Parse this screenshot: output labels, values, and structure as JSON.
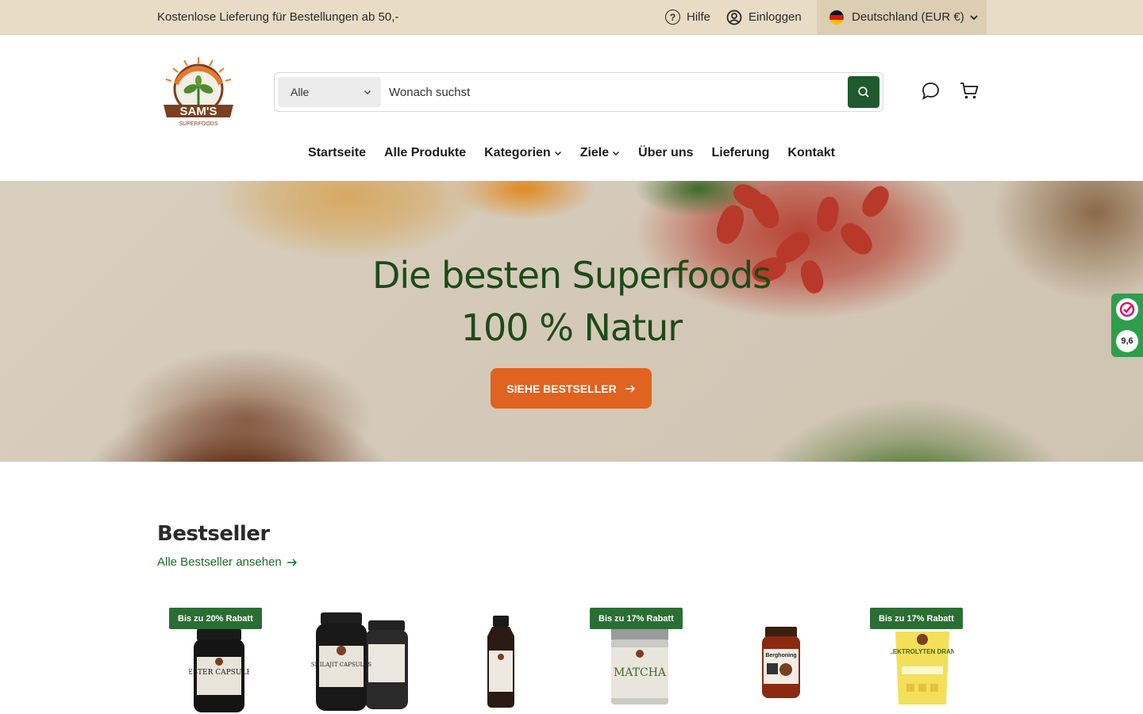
{
  "topbar": {
    "announcement": "Kostenlose Lieferung für Bestellungen ab 50,-",
    "help_label": "Hilfe",
    "login_label": "Einloggen",
    "country_label": "Deutschland (EUR €)"
  },
  "header": {
    "search": {
      "category": "Alle",
      "placeholder": "Wonach suchst"
    }
  },
  "nav": {
    "items": [
      "Startseite",
      "Alle Produkte",
      "Kategorien",
      "Ziele",
      "Über uns",
      "Lieferung",
      "Kontakt"
    ]
  },
  "hero": {
    "title_line1": "Die besten Superfoods",
    "title_line2": "100 % Natur",
    "cta_label": "SIEHE BESTSELLER"
  },
  "widget": {
    "score": "9,6"
  },
  "bestseller": {
    "title": "Bestseller",
    "link_label": "Alle Bestseller ansehen",
    "products": [
      {
        "badge": "Bis zu 20% Rabatt",
        "label": "OESTER CAPSULES"
      },
      {
        "badge": "",
        "label": "SHILAJIT CAPSULES"
      },
      {
        "badge": "",
        "label": ""
      },
      {
        "badge": "Bis zu 17% Rabatt",
        "label": "MATCHA"
      },
      {
        "badge": "",
        "label": "Berghoning"
      },
      {
        "badge": "Bis zu 17% Rabatt",
        "label": "ELEKTROLYTEN DRANK"
      }
    ]
  },
  "colors": {
    "topbar_bg": "#e9dcc6",
    "brand_green": "#1f5a2c",
    "cta_orange": "#e0631f",
    "hero_title": "#1e4a17"
  }
}
